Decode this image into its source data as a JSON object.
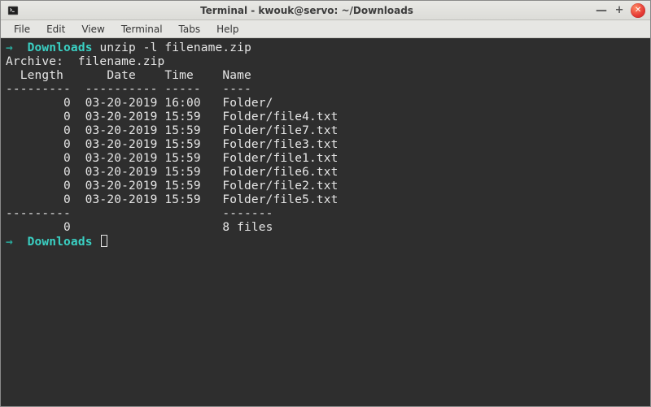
{
  "titlebar": {
    "title": "Terminal - kwouk@servo: ~/Downloads",
    "min_tip": "Minimize",
    "max_tip": "Maximize",
    "close_tip": "Close"
  },
  "menubar": {
    "items": [
      "File",
      "Edit",
      "View",
      "Terminal",
      "Tabs",
      "Help"
    ]
  },
  "prompt": {
    "arrow": "→",
    "cwd": "Downloads",
    "command1": "unzip -l filename.zip",
    "command2": ""
  },
  "output": {
    "archive_label": "Archive:",
    "archive_name": "filename.zip",
    "columns": {
      "length": "Length",
      "date": "Date",
      "time": "Time",
      "name": "Name"
    },
    "sep": {
      "len": "---------",
      "datetime": "----------",
      "time": "-----",
      "name": "----",
      "sum_name": "-------"
    },
    "rows": [
      {
        "length": 0,
        "date": "03-20-2019",
        "time": "16:00",
        "name": "Folder/"
      },
      {
        "length": 0,
        "date": "03-20-2019",
        "time": "15:59",
        "name": "Folder/file4.txt"
      },
      {
        "length": 0,
        "date": "03-20-2019",
        "time": "15:59",
        "name": "Folder/file7.txt"
      },
      {
        "length": 0,
        "date": "03-20-2019",
        "time": "15:59",
        "name": "Folder/file3.txt"
      },
      {
        "length": 0,
        "date": "03-20-2019",
        "time": "15:59",
        "name": "Folder/file1.txt"
      },
      {
        "length": 0,
        "date": "03-20-2019",
        "time": "15:59",
        "name": "Folder/file6.txt"
      },
      {
        "length": 0,
        "date": "03-20-2019",
        "time": "15:59",
        "name": "Folder/file2.txt"
      },
      {
        "length": 0,
        "date": "03-20-2019",
        "time": "15:59",
        "name": "Folder/file5.txt"
      }
    ],
    "total_length": 0,
    "total_files_label": "8 files"
  }
}
